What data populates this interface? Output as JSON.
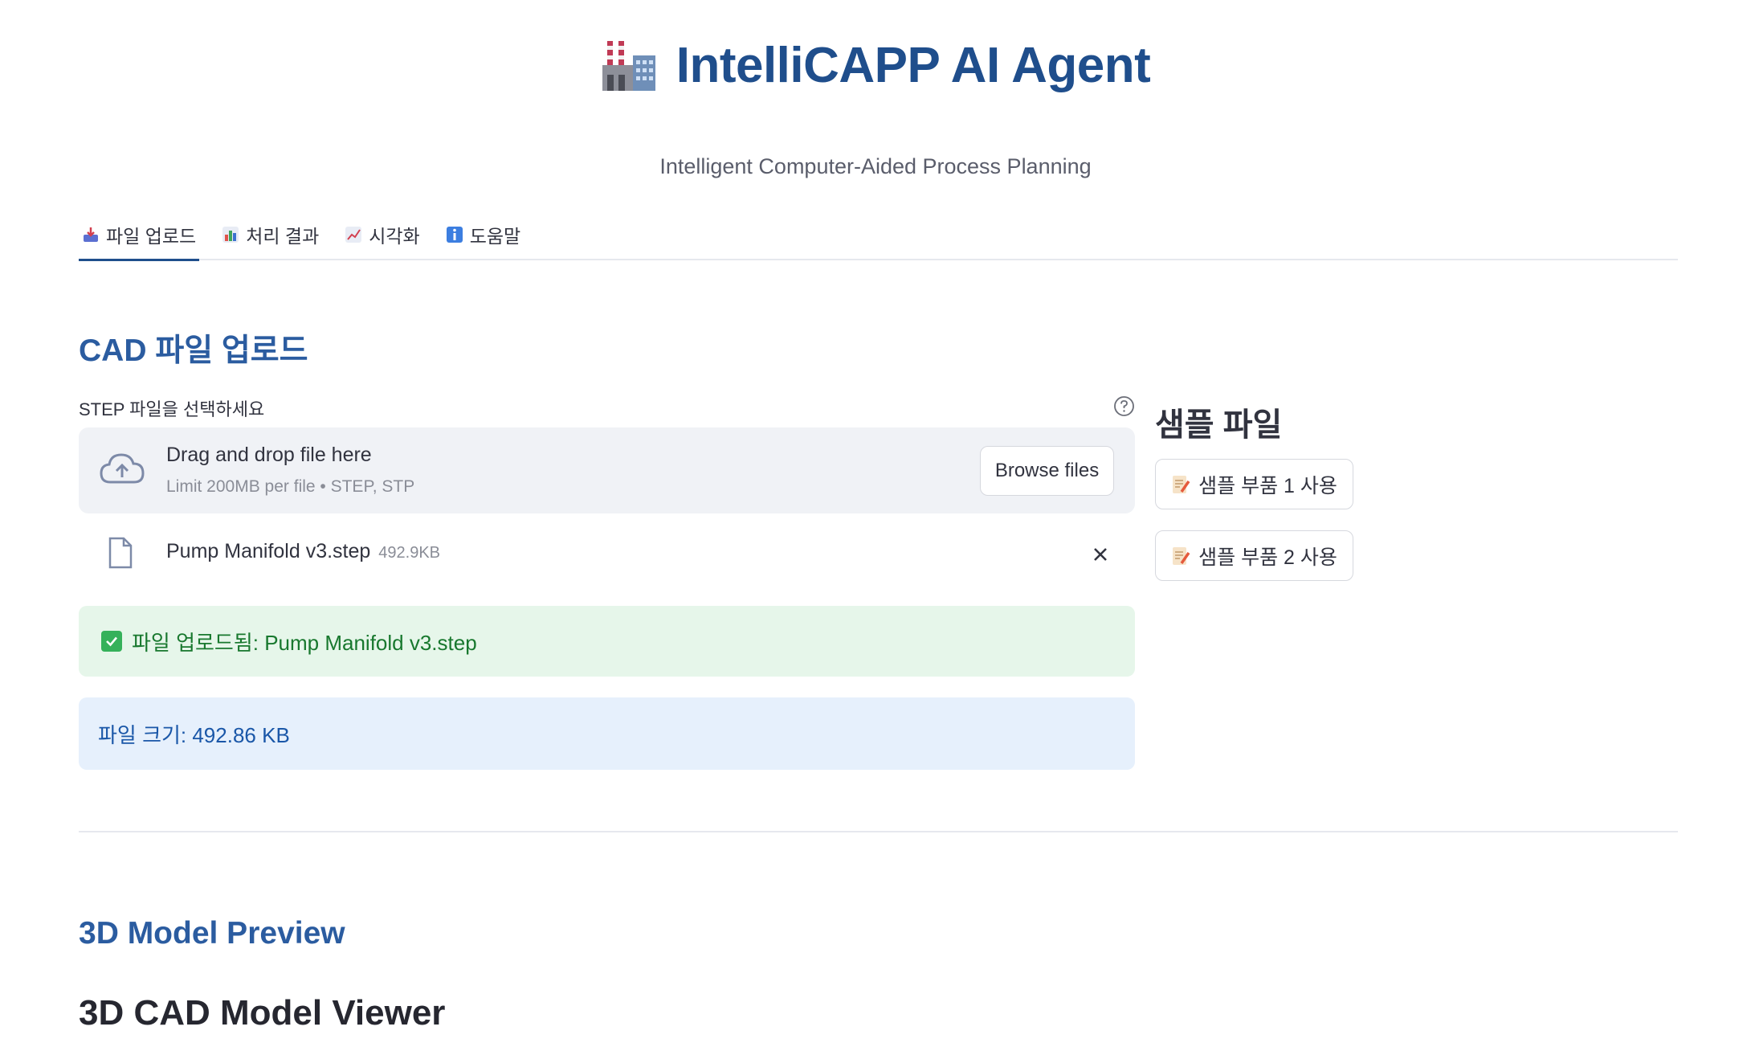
{
  "header": {
    "title": "IntelliCAPP AI Agent",
    "title_icon": "factory-icon",
    "subtitle": "Intelligent Computer-Aided Process Planning"
  },
  "tabs": [
    {
      "label": "파일 업로드",
      "icon": "inbox-tray-icon",
      "active": true
    },
    {
      "label": "처리 결과",
      "icon": "bar-chart-icon",
      "active": false
    },
    {
      "label": "시각화",
      "icon": "chart-increasing-icon",
      "active": false
    },
    {
      "label": "도움말",
      "icon": "info-icon",
      "active": false
    }
  ],
  "upload_section": {
    "heading": "CAD 파일 업로드",
    "label": "STEP 파일을 선택하세요",
    "dropzone": {
      "text": "Drag and drop file here",
      "limit": "Limit 200MB per file • STEP, STP",
      "browse_label": "Browse files"
    },
    "uploaded_file": {
      "name": "Pump Manifold v3.step",
      "size": "492.9KB"
    },
    "success_message": "파일 업로드됨: Pump Manifold v3.step",
    "info_message": "파일 크기: 492.86 KB"
  },
  "sample_section": {
    "heading": "샘플 파일",
    "buttons": [
      {
        "label": "샘플 부품 1 사용",
        "icon": "memo-icon"
      },
      {
        "label": "샘플 부품 2 사용",
        "icon": "memo-icon"
      }
    ]
  },
  "preview_section": {
    "heading": "3D Model Preview",
    "viewer_title": "3D CAD Model Viewer"
  },
  "colors": {
    "title": "#1f4e8c",
    "heading": "#2b5ca0",
    "success_bg": "#e6f6ea",
    "success_text": "#18782e",
    "info_bg": "#e6f0fc",
    "info_text": "#1a57a8"
  }
}
